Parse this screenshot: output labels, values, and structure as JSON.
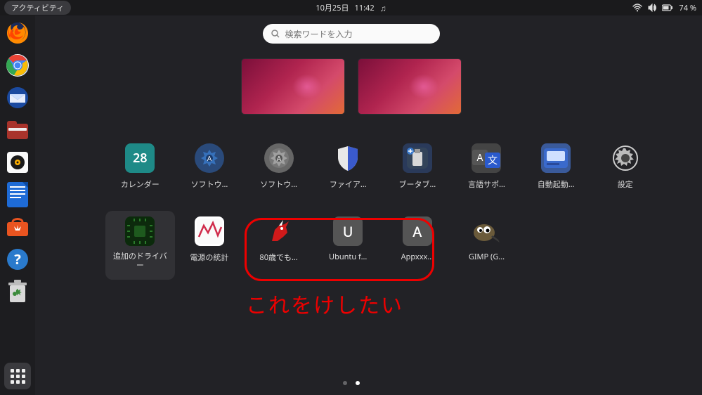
{
  "topbar": {
    "activities": "アクティビティ",
    "date": "10月25日",
    "time": "11:42",
    "battery": "74 %"
  },
  "search": {
    "placeholder": "検索ワードを入力"
  },
  "apps_row1": [
    {
      "label": "カレンダー",
      "num": "28"
    },
    {
      "label": "ソフトウ…"
    },
    {
      "label": "ソフトウ…"
    },
    {
      "label": "ファイア…"
    },
    {
      "label": "ブータブ…"
    },
    {
      "label": "言語サポ…"
    },
    {
      "label": "自動起動…"
    },
    {
      "label": "設定"
    }
  ],
  "apps_row2": [
    {
      "label": "追加のドライバー"
    },
    {
      "label": "電源の統計"
    },
    {
      "label": "80歳でも…"
    },
    {
      "label": "Ubuntu f…",
      "letter": "U"
    },
    {
      "label": "Appxxx…",
      "letter": "A"
    },
    {
      "label": "GIMP (G…"
    }
  ],
  "annotation": {
    "text": "これをけしたい"
  }
}
